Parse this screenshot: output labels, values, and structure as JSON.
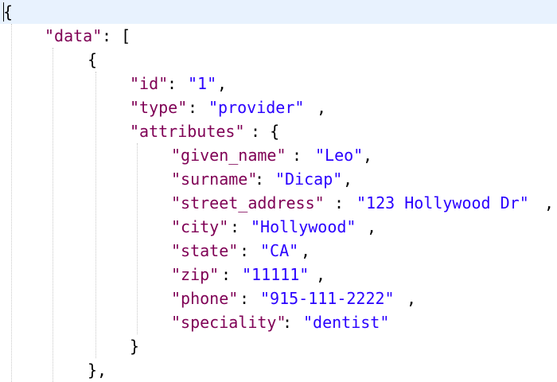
{
  "editor": {
    "lines": [
      {
        "open": "{"
      },
      {
        "key": "\"data\"",
        "after": ": ["
      },
      {
        "open": "{"
      },
      {
        "key": "\"id\"",
        "sep": ": ",
        "value": "\"1\"",
        "after": ","
      },
      {
        "key": "\"type\"",
        "sep": ": ",
        "value": "\"provider\"",
        "after": ","
      },
      {
        "key": "\"attributes\"",
        "after": ": {"
      },
      {
        "key": "\"given_name\"",
        "sep": ": ",
        "value": "\"Leo\"",
        "after": ","
      },
      {
        "key": "\"surname\"",
        "sep": ": ",
        "value": "\"Dicap\"",
        "after": ","
      },
      {
        "key": "\"street_address\"",
        "sep": ": ",
        "value": "\"123 Hollywood Dr\"",
        "after": ","
      },
      {
        "key": "\"city\"",
        "sep": ": ",
        "value": "\"Hollywood\"",
        "after": ","
      },
      {
        "key": "\"state\"",
        "sep": ": ",
        "value": "\"CA\"",
        "after": ","
      },
      {
        "key": "\"zip\"",
        "sep": ": ",
        "value": "\"11111\"",
        "after": ","
      },
      {
        "key": "\"phone\"",
        "sep": ": ",
        "value": "\"915-111-2222\"",
        "after": ","
      },
      {
        "key": "\"speciality\"",
        "sep": ": ",
        "value": "\"dentist\""
      },
      {
        "close": "}"
      },
      {
        "close": "},"
      }
    ]
  },
  "colors": {
    "key": "#7f0055",
    "string": "#2a00ff",
    "current_line": "#e8f2fe",
    "indent_guide": "#c8c8c8"
  }
}
